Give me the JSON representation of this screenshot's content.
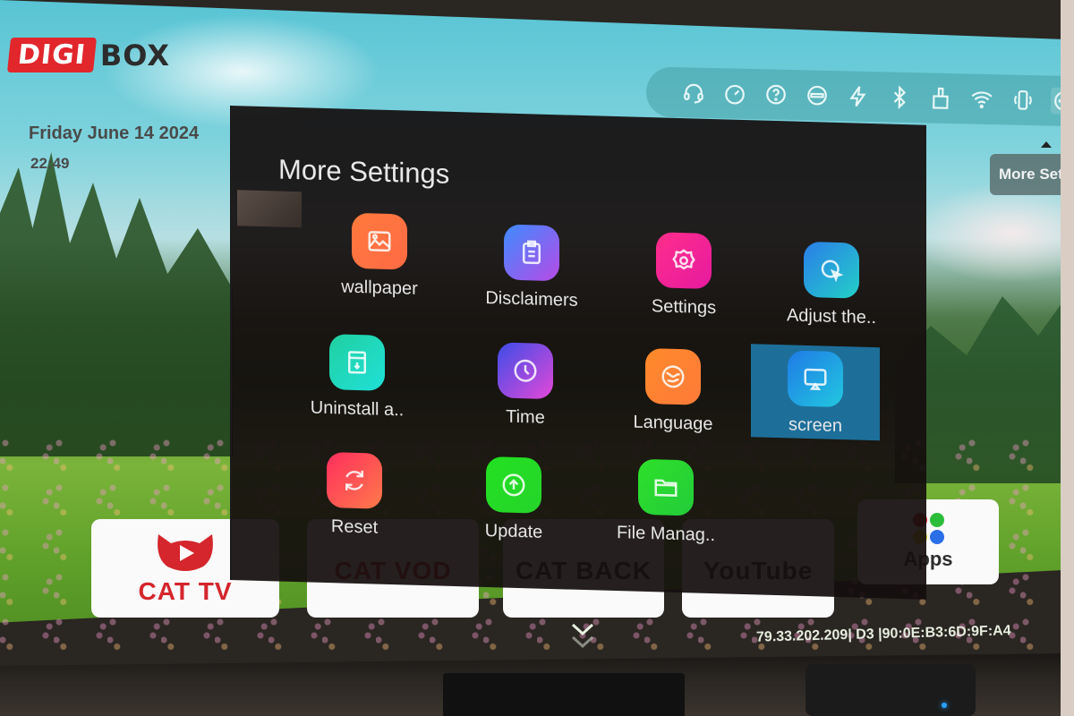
{
  "brand": {
    "logo_red": "DIGI",
    "logo_dark": "BOX"
  },
  "clock": {
    "date": "Friday June 14 2024",
    "time": "22:49"
  },
  "status_bar": {
    "icons": [
      {
        "name": "headset-icon",
        "label": "Support"
      },
      {
        "name": "speedometer-icon",
        "label": "Speed Test"
      },
      {
        "name": "help-icon",
        "label": "Help"
      },
      {
        "name": "no-entry-icon",
        "label": "Block"
      },
      {
        "name": "lightning-icon",
        "label": "Boost"
      },
      {
        "name": "bluetooth-icon",
        "label": "Bluetooth"
      },
      {
        "name": "brush-icon",
        "label": "Clean"
      },
      {
        "name": "wifi-icon",
        "label": "Wi-Fi"
      },
      {
        "name": "phone-rotate-icon",
        "label": "Device"
      },
      {
        "name": "more-icon",
        "label": "More Settings",
        "active": true
      }
    ],
    "tooltip": "More Settings"
  },
  "panel": {
    "title": "More Settings",
    "items": [
      {
        "label": "wallpaper",
        "icon": "image-icon",
        "color_from": "#ff7a3d",
        "color_to": "#ff6a45"
      },
      {
        "label": "Disclaimers",
        "icon": "clipboard-icon",
        "color_from": "#3d8cff",
        "color_to": "#b84ae6"
      },
      {
        "label": "Settings",
        "icon": "settings-flower-icon",
        "color_from": "#ff2e8a",
        "color_to": "#e61aa0"
      },
      {
        "label": "Adjust the..",
        "icon": "cursor-circle-icon",
        "color_from": "#2a7de8",
        "color_to": "#23d0c8"
      },
      {
        "label": "Uninstall a..",
        "icon": "uninstall-icon",
        "color_from": "#21d0a0",
        "color_to": "#1fe0d8"
      },
      {
        "label": "Time",
        "icon": "clock-icon",
        "color_from": "#3b4de8",
        "color_to": "#e548d8"
      },
      {
        "label": "Language",
        "icon": "globe-icon",
        "color_from": "#ff8a2a",
        "color_to": "#ff7a3a"
      },
      {
        "label": "screen",
        "icon": "cast-screen-icon",
        "color_from": "#1f7ae6",
        "color_to": "#22c8e0",
        "selected": true
      },
      {
        "label": "Reset",
        "icon": "refresh-icon",
        "color_from": "#ff2e5e",
        "color_to": "#ff7a4a"
      },
      {
        "label": "Update",
        "icon": "upload-circle-icon",
        "color_from": "#22e020",
        "color_to": "#26d42c"
      },
      {
        "label": "File Manag..",
        "icon": "folder-icon",
        "color_from": "#2ee02a",
        "color_to": "#22cc3a"
      }
    ]
  },
  "home_tiles": [
    {
      "label": "CAT TV",
      "icon": "cat-play-icon"
    },
    {
      "label": "CAT VOD",
      "icon": "cat-vod-icon"
    },
    {
      "label": "CAT BACK",
      "icon": "cat-back-icon"
    },
    {
      "label": "YouTube",
      "icon": "youtube-icon"
    },
    {
      "label": "Apps",
      "icon": "apps-grid-icon"
    }
  ],
  "footer": {
    "network_info": "79.33.202.209| D3 |90:0E:B3:6D:9F:A4"
  },
  "colors": {
    "accent_red": "#e1262c",
    "selected_bg": "#1d6f9a",
    "panel_bg": "#140e0e"
  }
}
